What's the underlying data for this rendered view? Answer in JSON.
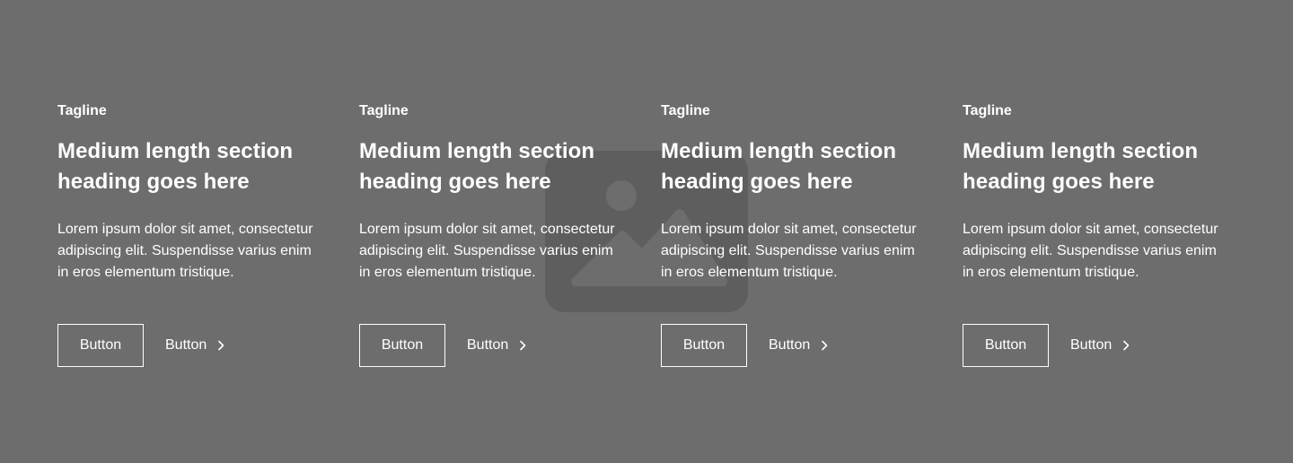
{
  "background": {
    "color": "#6d6d6d",
    "placeholder_icon": "image-placeholder-icon",
    "placeholder_color": "#5e5e5e"
  },
  "cards": [
    {
      "tagline": "Tagline",
      "heading": "Medium length section heading goes here",
      "body": "Lorem ipsum dolor sit amet, consectetur adipiscing elit. Suspendisse varius enim in eros elementum tristique.",
      "primary_button": "Button",
      "secondary_button": "Button",
      "secondary_icon": "chevron-right-icon"
    },
    {
      "tagline": "Tagline",
      "heading": "Medium length section heading goes here",
      "body": "Lorem ipsum dolor sit amet, consectetur adipiscing elit. Suspendisse varius enim in eros elementum tristique.",
      "primary_button": "Button",
      "secondary_button": "Button",
      "secondary_icon": "chevron-right-icon"
    },
    {
      "tagline": "Tagline",
      "heading": "Medium length section heading goes here",
      "body": "Lorem ipsum dolor sit amet, consectetur adipiscing elit. Suspendisse varius enim in eros elementum tristique.",
      "primary_button": "Button",
      "secondary_button": "Button",
      "secondary_icon": "chevron-right-icon"
    },
    {
      "tagline": "Tagline",
      "heading": "Medium length section heading goes here",
      "body": "Lorem ipsum dolor sit amet, consectetur adipiscing elit. Suspendisse varius enim in eros elementum tristique.",
      "primary_button": "Button",
      "secondary_button": "Button",
      "secondary_icon": "chevron-right-icon"
    }
  ]
}
